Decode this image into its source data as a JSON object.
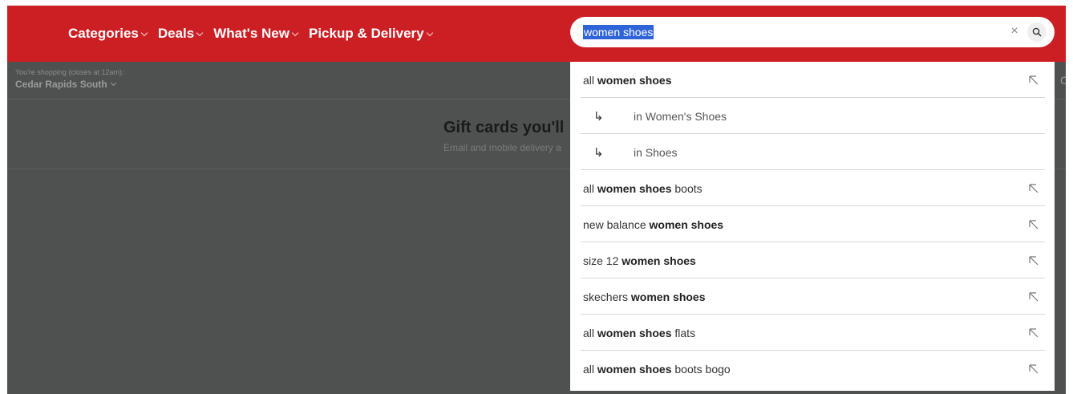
{
  "nav": {
    "items": [
      {
        "label": "Categories"
      },
      {
        "label": "Deals"
      },
      {
        "label": "What's New"
      },
      {
        "label": "Pickup & Delivery"
      }
    ]
  },
  "search": {
    "value": "women shoes",
    "clear_icon": "×",
    "search_icon": "search-icon"
  },
  "store": {
    "caption": "You're shopping (closes at 12am):",
    "name": "Cedar Rapids South",
    "right_edge": "C"
  },
  "promo": {
    "title": "Gift cards you'll",
    "subtitle": "Email and mobile delivery a"
  },
  "suggestions": [
    {
      "pre": "all ",
      "bold": "women shoes",
      "post": ""
    },
    {
      "sub": "in Women's Shoes"
    },
    {
      "sub": "in Shoes"
    },
    {
      "pre": "all ",
      "bold": "women shoes",
      "post": " boots"
    },
    {
      "pre": "new balance ",
      "bold": "women shoes",
      "post": ""
    },
    {
      "pre": "size 12 ",
      "bold": "women shoes",
      "post": ""
    },
    {
      "pre": "skechers ",
      "bold": "women shoes",
      "post": ""
    },
    {
      "pre": "all ",
      "bold": "women shoes",
      "post": " flats"
    },
    {
      "pre": "all ",
      "bold": "women shoes",
      "post": " boots bogo"
    }
  ],
  "colors": {
    "brand_red": "#cc1f24",
    "overlay": "#4f5050",
    "selection": "#2f64d8"
  }
}
